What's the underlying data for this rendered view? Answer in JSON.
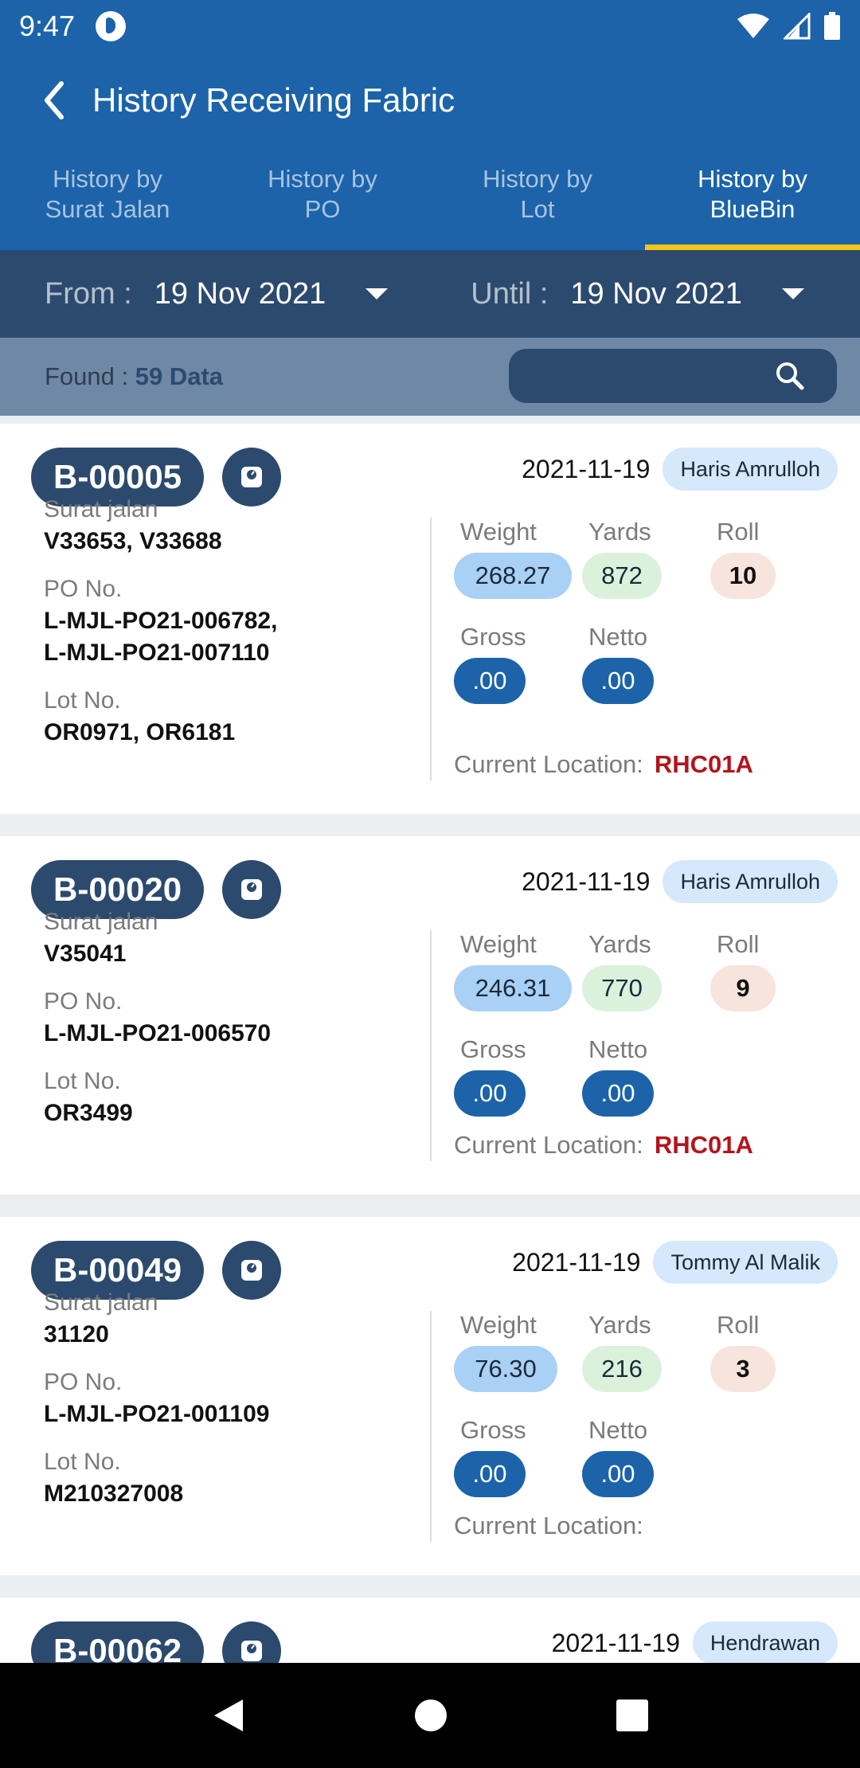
{
  "status": {
    "time": "9:47"
  },
  "appbar": {
    "title": "History Receiving Fabric"
  },
  "tabs": [
    {
      "line1": "History by",
      "line2": "Surat Jalan",
      "active": false
    },
    {
      "line1": "History by",
      "line2": "PO",
      "active": false
    },
    {
      "line1": "History by",
      "line2": "Lot",
      "active": false
    },
    {
      "line1": "History by",
      "line2": "BlueBin",
      "active": true
    }
  ],
  "dates": {
    "from_label": "From :",
    "from_value": "19 Nov 2021",
    "until_label": "Until :",
    "until_value": "19 Nov 2021"
  },
  "found": {
    "label": "Found :",
    "value": "59 Data"
  },
  "search": {
    "placeholder": ""
  },
  "labels": {
    "surat_jalan": "Surat jalan",
    "po_no": "PO No.",
    "lot_no": "Lot No.",
    "weight": "Weight",
    "yards": "Yards",
    "roll": "Roll",
    "gross": "Gross",
    "netto": "Netto",
    "current_location": "Current Location:"
  },
  "cards": [
    {
      "id": "B-00005",
      "date": "2021-11-19",
      "user": "Haris Amrulloh",
      "surat_jalan": "V33653, V33688",
      "po_lines": [
        "L-MJL-PO21-006782,",
        "L-MJL-PO21-007110"
      ],
      "lot_no": "OR0971, OR6181",
      "weight": "268.27",
      "yards": "872",
      "roll": "10",
      "gross": ".00",
      "netto": ".00",
      "location": "RHC01A"
    },
    {
      "id": "B-00020",
      "date": "2021-11-19",
      "user": "Haris Amrulloh",
      "surat_jalan": "V35041",
      "po_lines": [
        "L-MJL-PO21-006570"
      ],
      "lot_no": "OR3499",
      "weight": "246.31",
      "yards": "770",
      "roll": "9",
      "gross": ".00",
      "netto": ".00",
      "location": "RHC01A"
    },
    {
      "id": "B-00049",
      "date": "2021-11-19",
      "user": "Tommy Al Malik",
      "surat_jalan": "31120",
      "po_lines": [
        "L-MJL-PO21-001109"
      ],
      "lot_no": "M210327008",
      "weight": "76.30",
      "yards": "216",
      "roll": "3",
      "gross": ".00",
      "netto": ".00",
      "location": ""
    },
    {
      "id": "B-00062",
      "date": "2021-11-19",
      "user": "Hendrawan"
    }
  ],
  "icons": {
    "back": "back-arrow-icon",
    "dropdown": "caret-down-icon",
    "search": "search-icon",
    "scale": "scale-icon"
  }
}
